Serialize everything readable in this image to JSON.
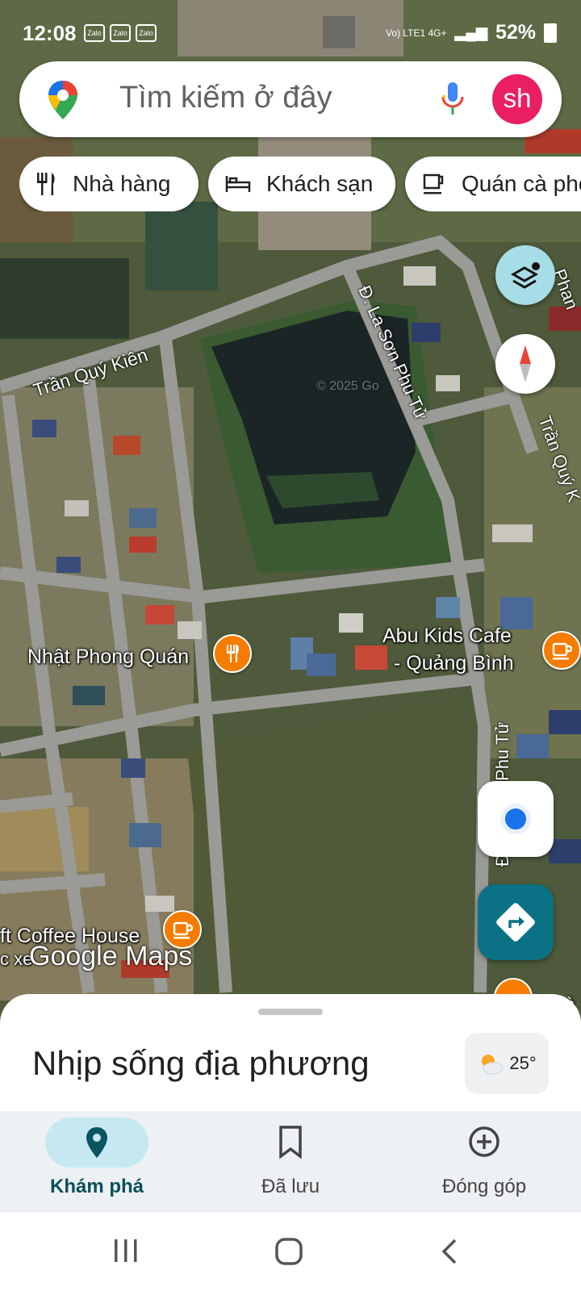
{
  "status_bar": {
    "time": "12:08",
    "apps": [
      "Zalo",
      "Zalo",
      "Zalo"
    ],
    "network": "Vo) LTE1 4G+",
    "battery": "52%"
  },
  "search": {
    "placeholder": "Tìm kiếm ở đây",
    "avatar_initials": "sh",
    "avatar_color": "#e91e63"
  },
  "chips": [
    {
      "label": "Nhà hàng",
      "icon": "fork-knife-icon"
    },
    {
      "label": "Khách sạn",
      "icon": "bed-icon"
    },
    {
      "label": "Quán cà phê",
      "icon": "coffee-icon"
    }
  ],
  "map": {
    "streets": [
      "Trần Quý Kiên",
      "Đ. La Sơn Phu Tử",
      "Trần Quý K",
      "Phan",
      "Đ. La Sơn Phu Tử"
    ],
    "places": [
      {
        "name": "Nhật Phong Quán",
        "type": "restaurant"
      },
      {
        "name": "Abu Kids Cafe - Quảng Bình",
        "line1": "Abu Kids Cafe",
        "line2": "- Quảng Bình",
        "type": "cafe"
      },
      {
        "name": "ft Coffee House",
        "type": "cafe"
      }
    ],
    "watermark": "© 2025 Go",
    "logo": "Google Maps",
    "logo_prefix": "c xe",
    "edge_label": "hà"
  },
  "sheet": {
    "title": "Nhịp sống địa phương",
    "temperature": "25°"
  },
  "bottom_nav": [
    {
      "label": "Khám phá",
      "icon": "explore-pin-icon",
      "active": true
    },
    {
      "label": "Đã lưu",
      "icon": "bookmark-icon",
      "active": false
    },
    {
      "label": "Đóng góp",
      "icon": "add-circle-icon",
      "active": false
    }
  ],
  "colors": {
    "accent": "#0b7285",
    "active_pill": "#c6e9f1",
    "pin": "#f57c00"
  }
}
